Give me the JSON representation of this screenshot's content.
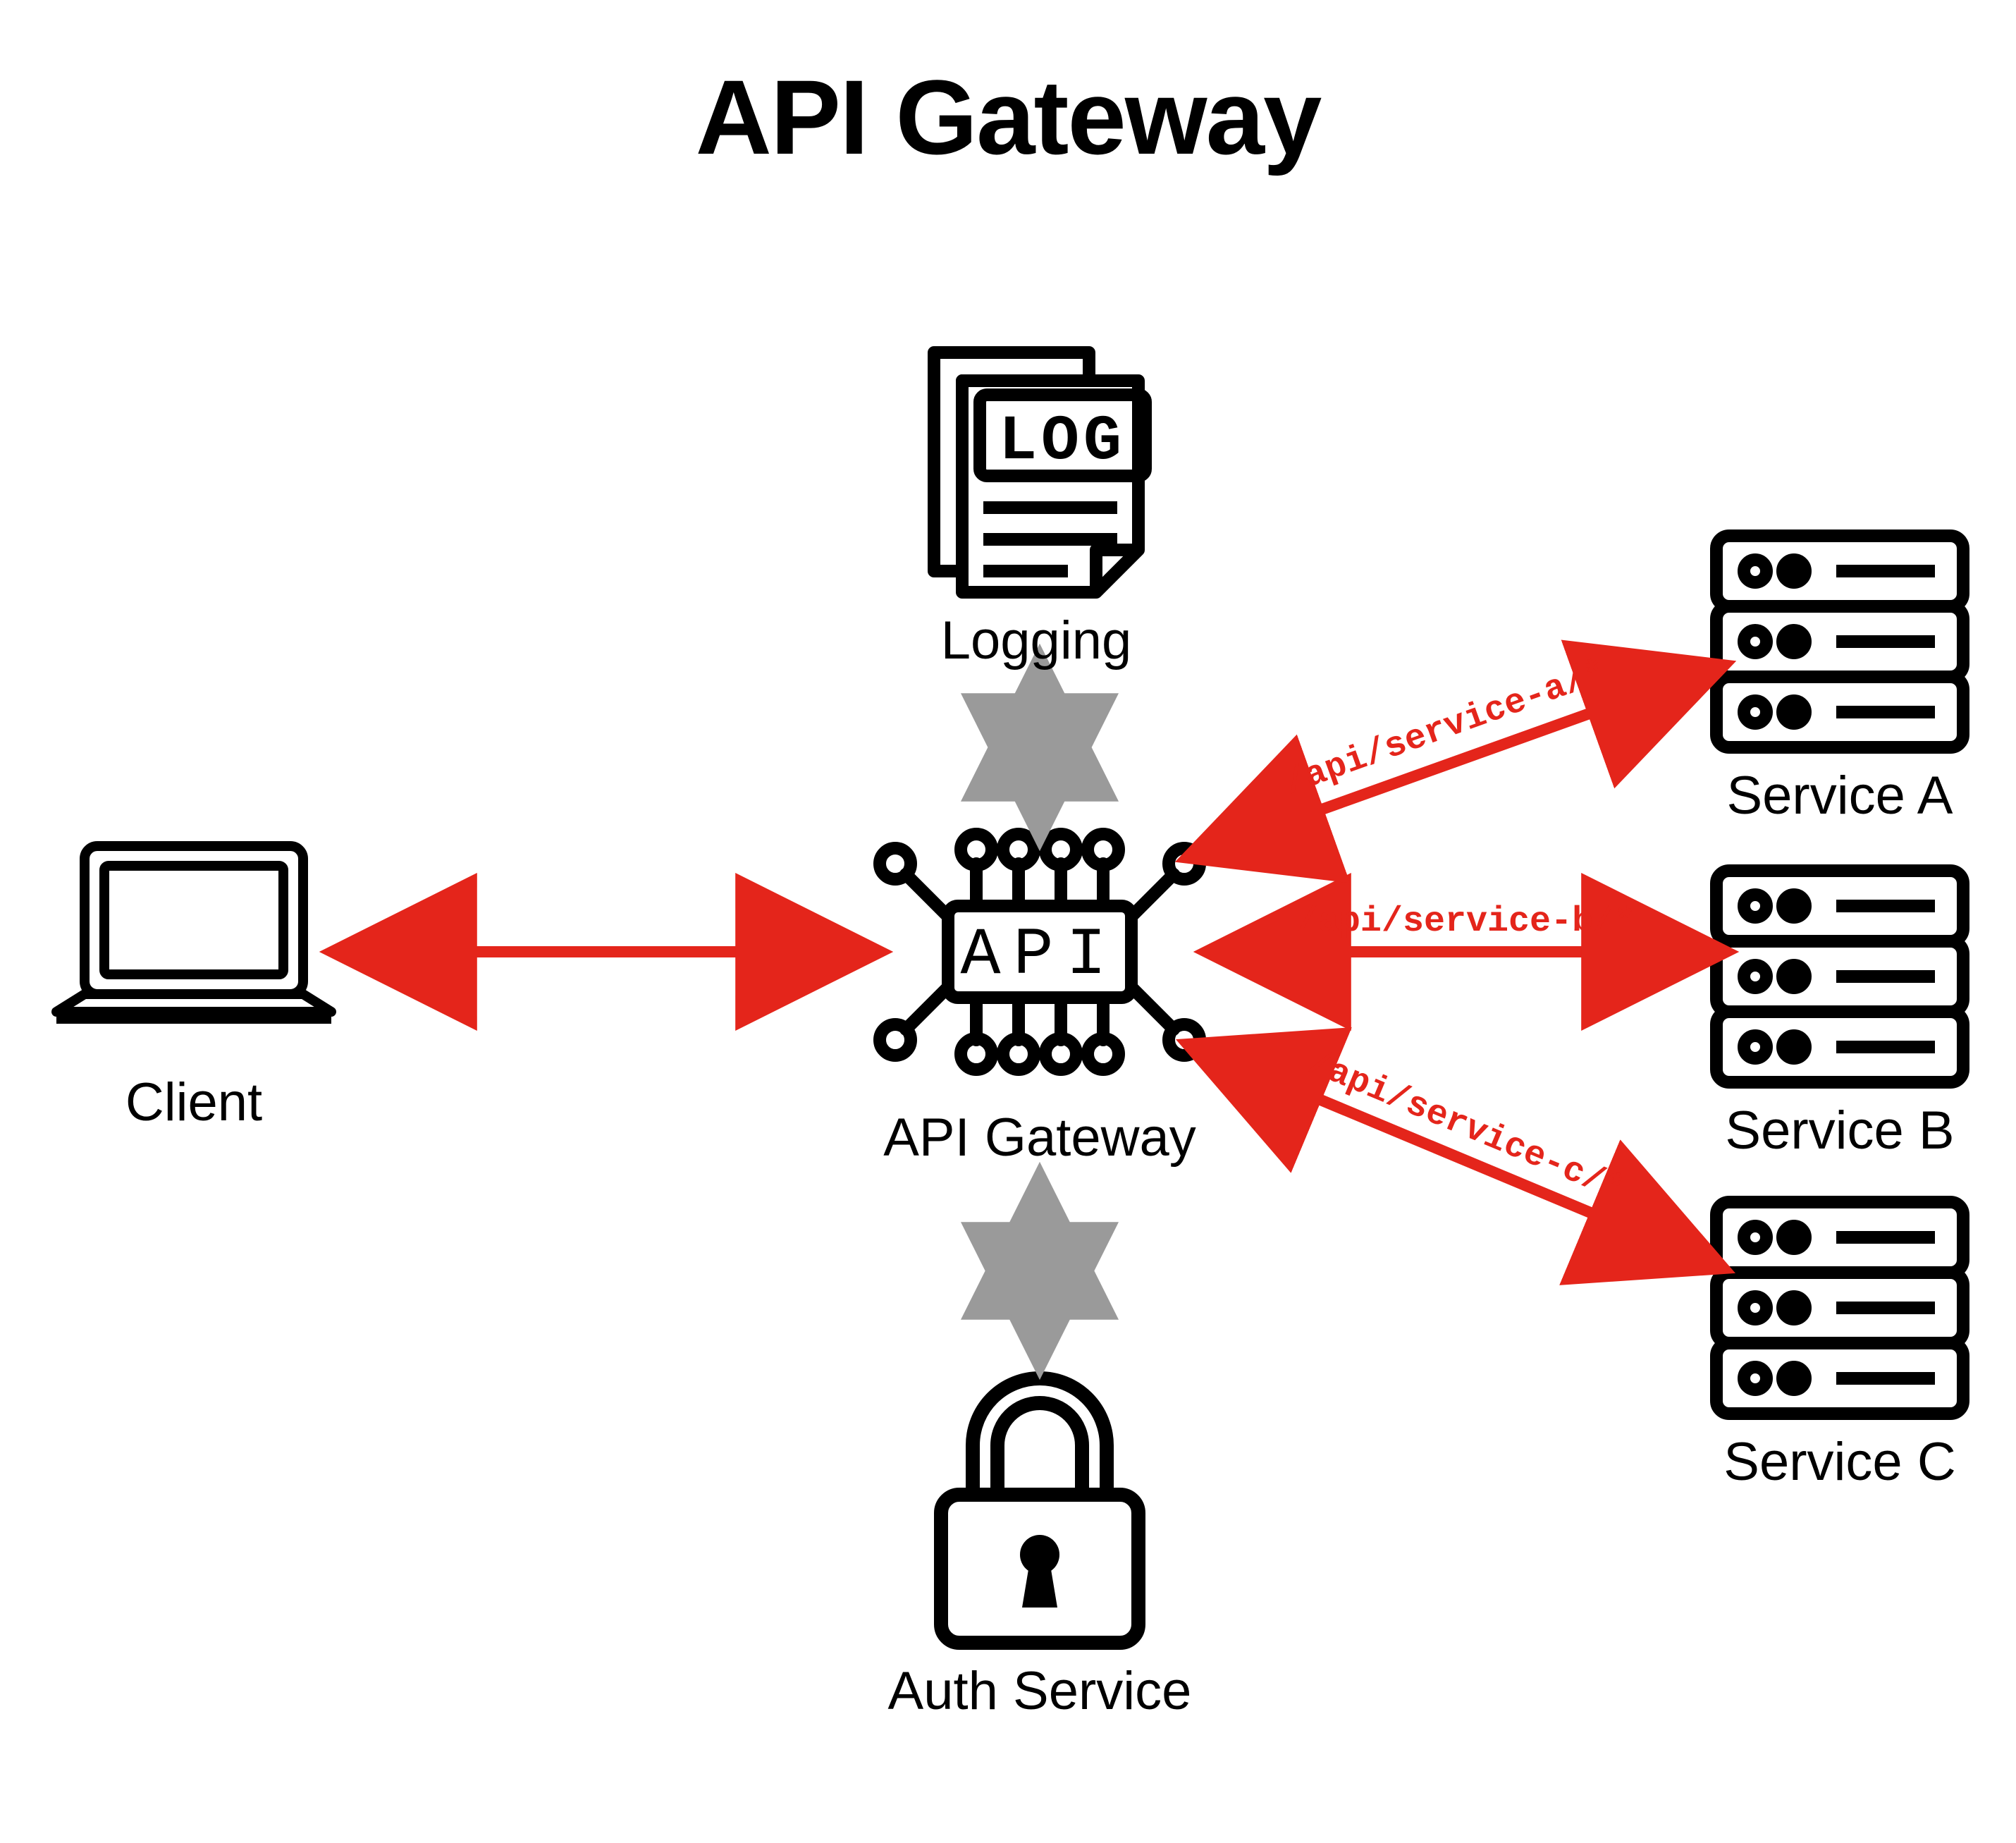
{
  "title": "API Gateway",
  "nodes": {
    "client": {
      "label": "Client"
    },
    "logging": {
      "label": "Logging",
      "iconText": "LOG"
    },
    "gateway": {
      "label": "API Gateway",
      "iconText": "API"
    },
    "auth": {
      "label": "Auth Service"
    },
    "serviceA": {
      "label": "Service A"
    },
    "serviceB": {
      "label": "Service B"
    },
    "serviceC": {
      "label": "Service C"
    }
  },
  "routes": {
    "a": "/api/service-a/*",
    "b": "/api/service-b/*",
    "c": "/api/service-c/*"
  },
  "colors": {
    "primaryArrow": "#e4251b",
    "secondaryArrow": "#9a9a9a",
    "icon": "#000000"
  }
}
